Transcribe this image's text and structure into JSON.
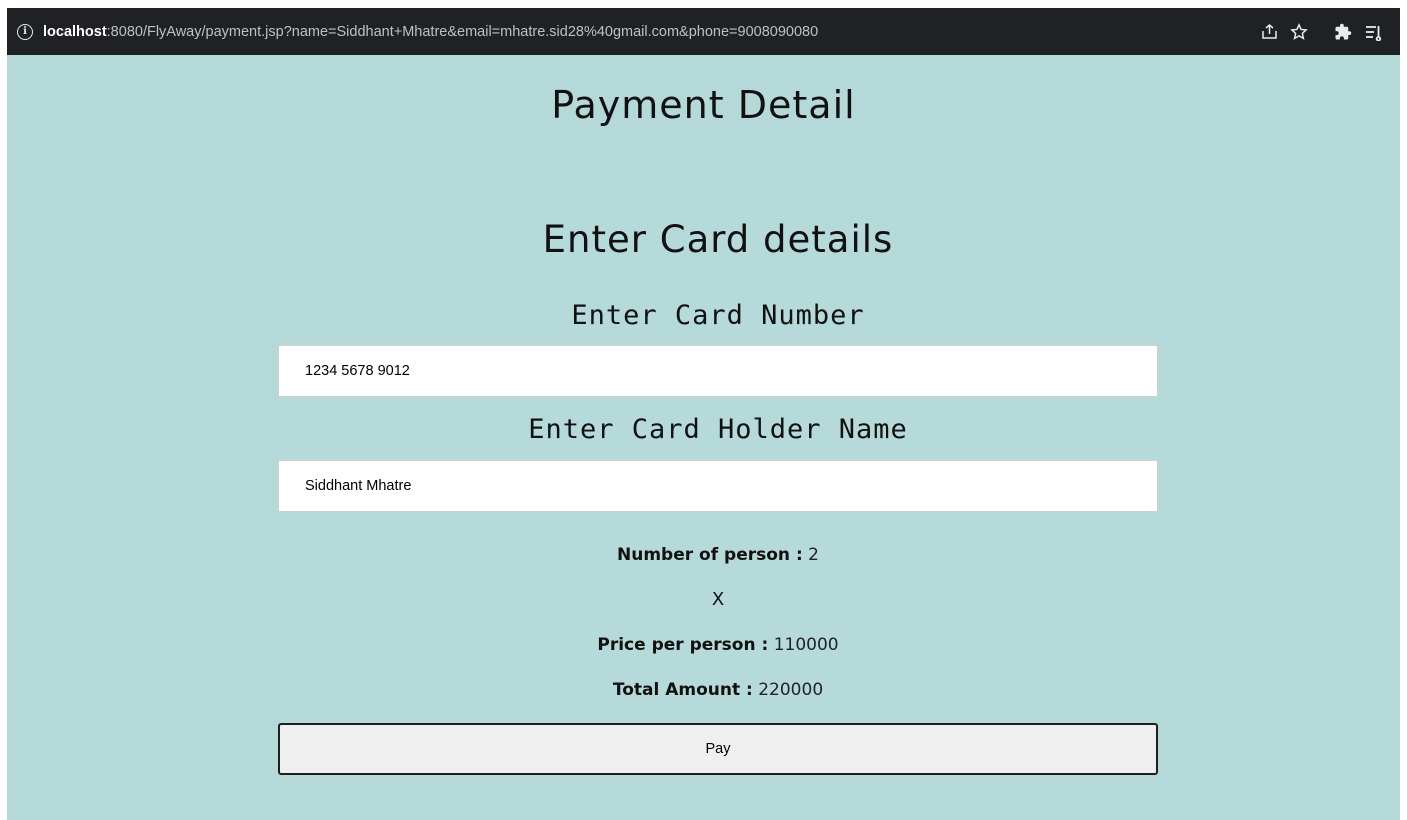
{
  "browser": {
    "url_host": "localhost",
    "url_rest": ":8080/FlyAway/payment.jsp?name=Siddhant+Mhatre&email=mhatre.sid28%40gmail.com&phone=9008090080",
    "icons": [
      "info-icon",
      "share-icon",
      "bookmark-star-icon",
      "extensions-puzzle-icon",
      "reading-list-icon"
    ]
  },
  "page": {
    "title": "Payment Detail",
    "background_color": "#b4d9d8"
  },
  "form": {
    "heading": "Enter Card details",
    "card_number_label": "Enter Card Number",
    "card_number_value": "1234 5678 9012",
    "card_holder_label": "Enter Card Holder Name",
    "card_holder_value": "Siddhant Mhatre",
    "persons_label": "Number of person :",
    "persons_value": "2",
    "multiply_sign": "X",
    "price_label": "Price per person :",
    "price_value": "110000",
    "total_label": "Total Amount :",
    "total_value": "220000",
    "pay_label": "Pay"
  }
}
